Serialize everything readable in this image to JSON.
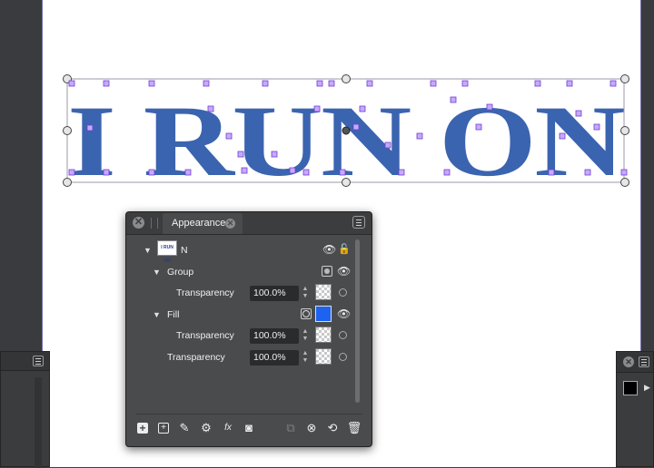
{
  "artwork": {
    "text": "I RUN ON",
    "fill_color": "#3b64b0"
  },
  "panel": {
    "tab_label": "Appearance",
    "layer": {
      "name": "N",
      "thumbnail_text": "I RUN ON"
    },
    "group": {
      "label": "Group"
    },
    "group_transparency": {
      "label": "Transparency",
      "value": "100.0%"
    },
    "fill": {
      "label": "Fill",
      "color": "#1e63f0"
    },
    "fill_transparency": {
      "label": "Transparency",
      "value": "100.0%"
    },
    "transparency": {
      "label": "Transparency",
      "value": "100.0%"
    }
  },
  "icons": [
    "close-icon",
    "grip-icon",
    "panel-menu-icon",
    "expand-triangle-icon",
    "eye-icon",
    "lock-icon",
    "stepper-icon",
    "add-box-icon",
    "add-circle-icon",
    "brush-plus-icon",
    "gear-icon",
    "fx-icon",
    "camera-icon",
    "duplicate-icon",
    "clear-icon",
    "refresh-icon",
    "trash-icon"
  ]
}
